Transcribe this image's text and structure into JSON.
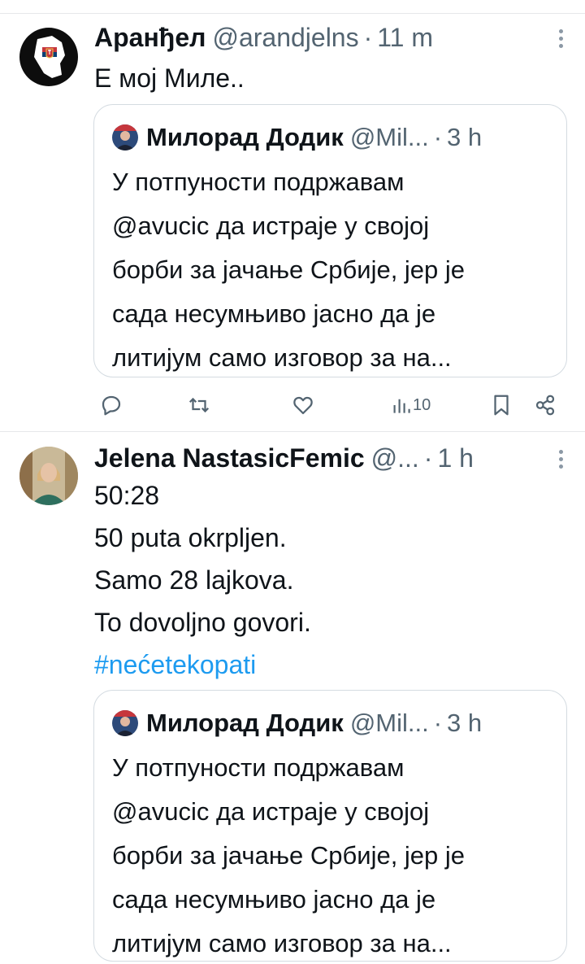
{
  "tweets": [
    {
      "name": "Аранђел",
      "handle": "@arandjelns",
      "dot": "·",
      "time": "11 m",
      "lines": [
        "Е мој Миле.."
      ],
      "quote": {
        "name": "Милорад Додик",
        "handle": "@Mil...",
        "dot": "·",
        "time": "3 h",
        "lines": [
          "У потпуности подржавам",
          "@avucic да истраје у својој",
          "борби за јачање Србије, јер је",
          "сада несумњиво јасно да је",
          "литијум само изговор за на..."
        ]
      },
      "actions": {
        "views": "10",
        "icons": [
          "reply-icon",
          "retweet-icon",
          "like-icon",
          "views-icon",
          "bookmark-icon",
          "share-icon"
        ]
      }
    },
    {
      "name": "Jelena NastasicFemic",
      "handle": "@...",
      "dot": "·",
      "time": "1 h",
      "lines": [
        "50:28",
        "50 puta okrpljen.",
        "Samo 28 lajkova.",
        "To dovoljno govori."
      ],
      "hashtag": "#nećetekopati",
      "quote": {
        "name": "Милорад Додик",
        "handle": "@Mil...",
        "dot": "·",
        "time": "3 h",
        "lines": [
          "У потпуности подржавам",
          "@avucic да истраје у својој",
          "борби за јачање Србије, јер је",
          "сада несумњиво јасно да је",
          "литијум само изговор за на..."
        ]
      }
    }
  ],
  "colors": {
    "text": "#0f1419",
    "secondary": "#536471",
    "link": "#1d9bf0",
    "border": "#d4dbe1"
  }
}
